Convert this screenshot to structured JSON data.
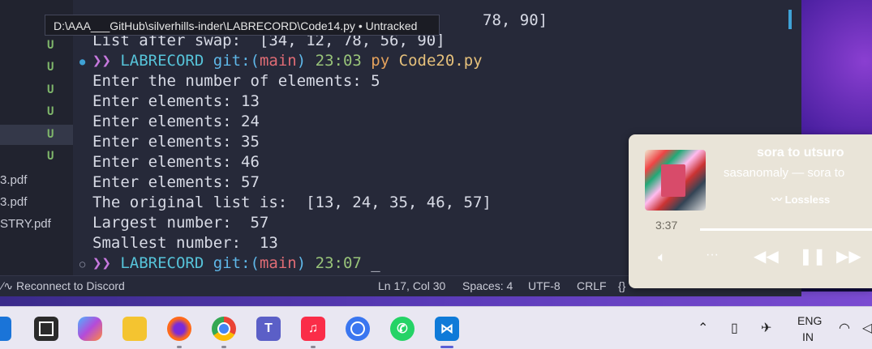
{
  "tooltip": {
    "text": "D:\\AAA___GitHub\\silverhills-inder\\LABRECORD\\Code14.py • Untracked"
  },
  "explorer": {
    "status_letters": [
      "U",
      "U",
      "U",
      "U",
      "U",
      "U",
      "U"
    ],
    "files": [
      "3.pdf",
      " 3.pdf",
      "STRY.pdf"
    ]
  },
  "terminal": {
    "partial_line": "78, 90]",
    "lines": [
      "List after swap:  [34, 12, 78, 56, 90]",
      "Enter the number of elements: 5",
      "Enter elements: 13",
      "Enter elements: 24",
      "Enter elements: 35",
      "Enter elements: 46",
      "Enter elements: 57",
      "The original list is:  [13, 24, 35, 46, 57]",
      "Largest number:  57",
      "Smallest number:  13"
    ],
    "prompt1": {
      "arrow": "❯❯",
      "dir": "LABRECORD",
      "git": "git:",
      "branch_open": "(",
      "branch": "main",
      "branch_close": ")",
      "time": "23:03",
      "cmd1": "py",
      "cmd2": "Code20.py"
    },
    "prompt2": {
      "arrow": "❯❯",
      "dir": "LABRECORD",
      "git": "git:",
      "branch_open": "(",
      "branch": "main",
      "branch_close": ")",
      "time": "23:07",
      "cursor": "_"
    }
  },
  "statusbar": {
    "discord": "Reconnect to Discord",
    "position": "Ln 17, Col 30",
    "spaces": "Spaces: 4",
    "encoding": "UTF-8",
    "eol": "CRLF",
    "braces": "{}"
  },
  "media": {
    "title": "sora to utsuro",
    "artist": "sasanomaly — sora to",
    "quality": "Lossless",
    "time": "3:37",
    "progress": 1.0
  },
  "taskbar": {
    "apps": [
      "windows-start",
      "task-view",
      "copilot",
      "file-explorer",
      "firefox",
      "chrome",
      "teams",
      "music",
      "signal",
      "whatsapp",
      "vscode"
    ],
    "lang_top": "ENG",
    "lang_bottom": "IN"
  },
  "colors": {
    "accent": "#3fa2d6",
    "prompt_arrow": "#c678dd",
    "branch": "#e06c75",
    "time": "#98c379"
  }
}
